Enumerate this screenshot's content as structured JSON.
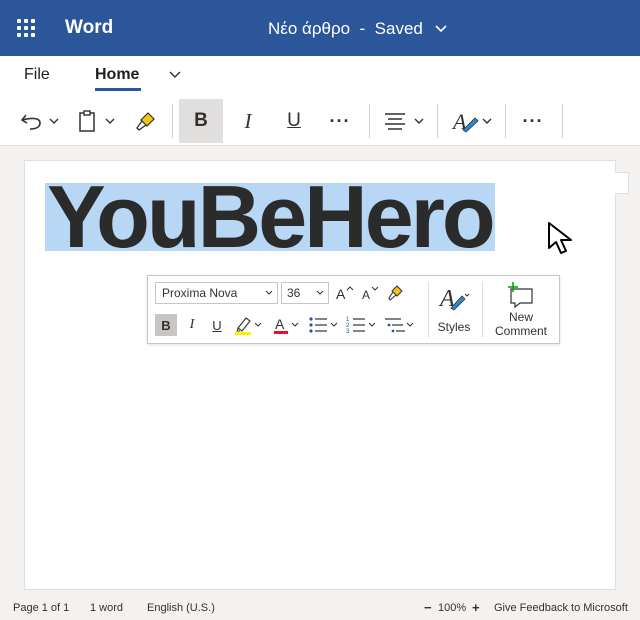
{
  "titlebar": {
    "app_name": "Word",
    "doc_title": "Νέο άρθρο  -  Saved"
  },
  "tabs": [
    {
      "label": "File"
    },
    {
      "label": "Home",
      "active": true
    }
  ],
  "toolbar": {
    "bold": "B",
    "italic": "I",
    "underline": "U",
    "more": "···"
  },
  "document": {
    "heading": "YouBeHero"
  },
  "mini_toolbar": {
    "font_name": "Proxima Nova",
    "font_size": "36",
    "bold": "B",
    "italic": "I",
    "underline": "U",
    "styles_label": "Styles",
    "new_comment_label": [
      "New",
      "Comment"
    ]
  },
  "status": {
    "page": "Page 1 of 1",
    "words": "1 word",
    "language": "English (U.S.)",
    "zoom_out": "−",
    "zoom": "100%",
    "zoom_in": "+",
    "feedback": "Give Feedback to Microsoft"
  },
  "colors": {
    "titlebar": "#2b579a",
    "selection": "#b7d7f5",
    "highlight_yellow": "#fff100",
    "font_red": "#e81123",
    "comment_green": "#13a10e"
  }
}
